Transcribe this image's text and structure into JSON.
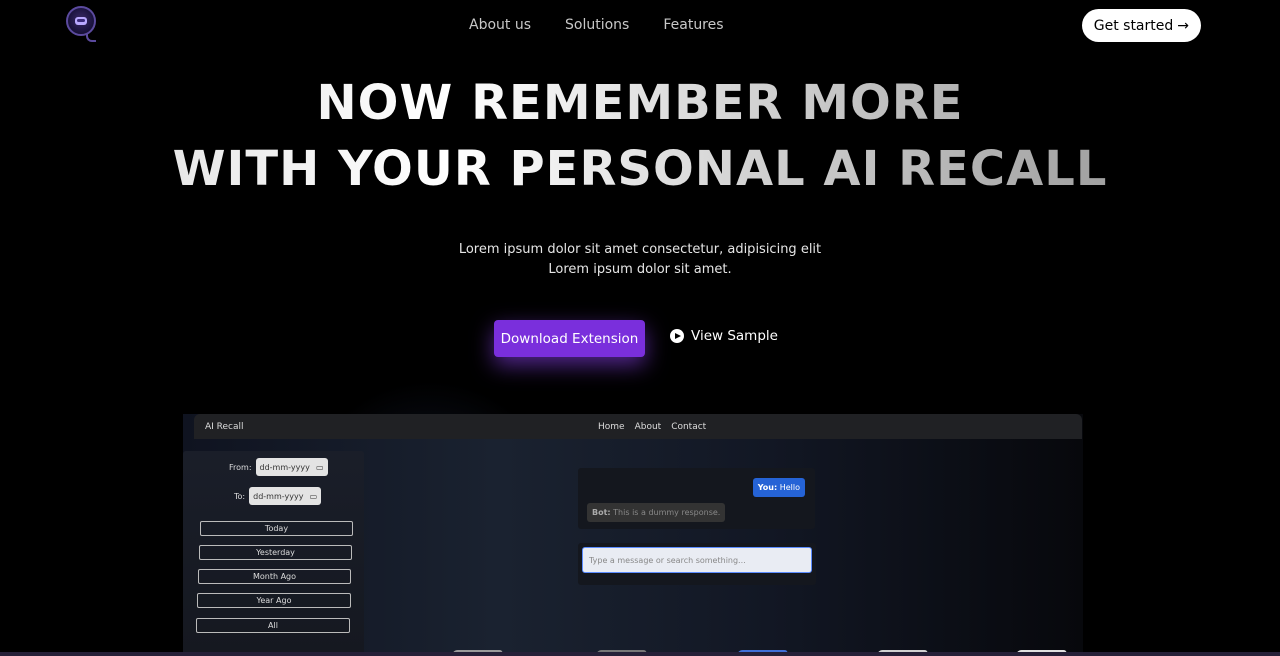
{
  "nav": {
    "links": [
      "About us",
      "Solutions",
      "Features"
    ],
    "cta_label": "Get started",
    "cta_arrow": "→"
  },
  "hero": {
    "line1": "NOW REMEMBER MORE",
    "line2": "WITH YOUR PERSONAL AI RECALL",
    "sub1": "Lorem ipsum dolor sit amet consectetur, adipisicing elit",
    "sub2": "Lorem ipsum dolor sit amet.",
    "download_label": "Download Extension",
    "view_label": "View Sample"
  },
  "mockup": {
    "brand": "AI Recall",
    "nav": [
      "Home",
      "About",
      "Contact"
    ],
    "from_label": "From:",
    "to_label": "To:",
    "date_placeholder": "dd-mm-yyyy",
    "filters": [
      "Today",
      "Yesterday",
      "Month Ago",
      "Year Ago",
      "All"
    ],
    "you_prefix": "You:",
    "you_text": "Hello",
    "bot_prefix": "Bot:",
    "bot_text": "This is a dummy response.",
    "input_placeholder": "Type a message or search something..."
  },
  "colors": {
    "accent": "#7a2fdc",
    "chat_user": "#2563d6"
  }
}
